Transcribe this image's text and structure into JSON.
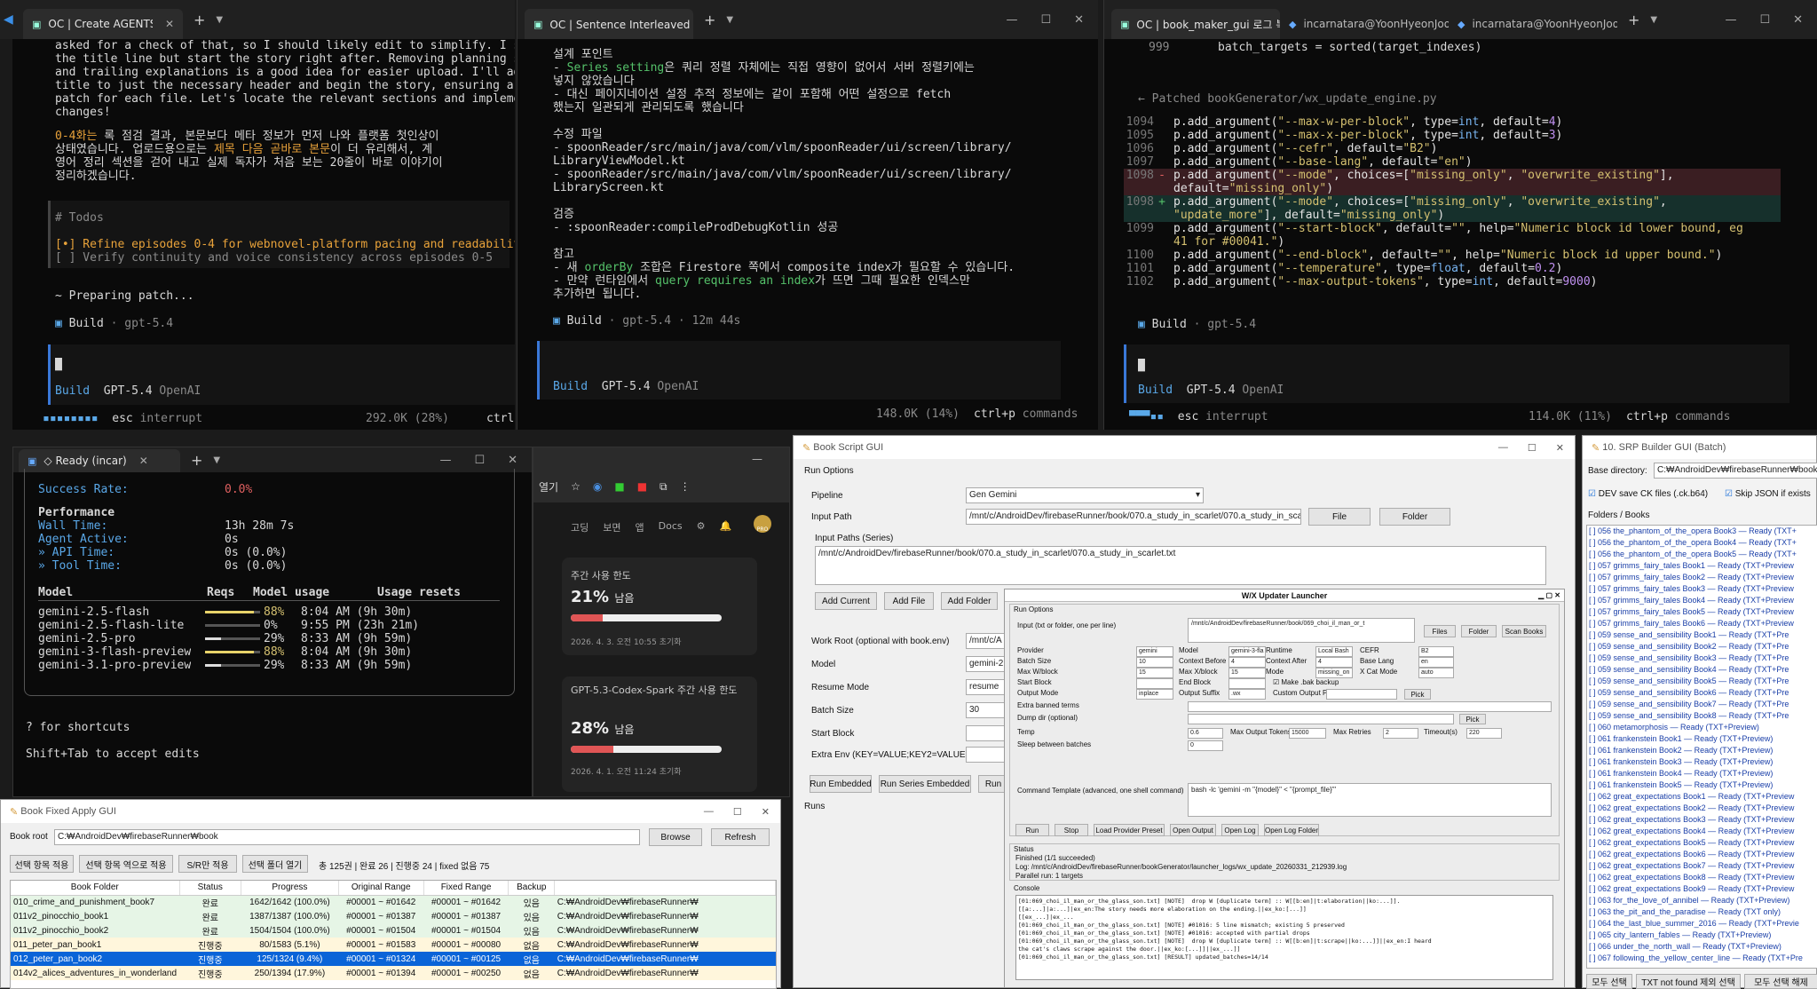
{
  "t1": {
    "tab": "OC | Create AGENTS.md for re",
    "lines": [
      "asked for a check of that, so I should likely edit to simplify. I sho",
      "the title line but start the story right after. Removing planning sec",
      "and trailing explanations is a good idea for easier upload. I'll adju",
      "title to just the necessary header and begin the story, ensuring a co",
      "patch for each file. Let's locate the relevant sections and implement",
      "changes!"
    ],
    "k1a": "0-4화는",
    "k1b": " 록 점검 결과, 본문보다 메타 정보가 먼저 나와 플랫폼 첫인상이",
    "k2a": "상태였습니다. 업로드용으로는 ",
    "k2b": "제목 다음 곧바로 본문",
    "k2c": "이 더 유리해서, 계",
    "k3": "영어 정리 섹션을 걷어 내고 실제 독자가 처음 보는 20줄이 바로 이야기이",
    "k4": "정리하겠습니다.",
    "todos_h": "# Todos",
    "todo1": "[•] Refine episodes 0-4 for webnovel-platform pacing and readability",
    "todo2": "[ ] Verify continuity and voice consistency across episodes 0-5",
    "prep": "~ Preparing patch...",
    "build": "Build",
    "model": "gpt-5.4",
    "b_build": "Build",
    "b_model": "GPT-5.4",
    "b_prov": "OpenAI",
    "esc": "esc",
    "interrupt": "interrupt",
    "tokens": "292.0K (28%)",
    "ctrl": "ctrl"
  },
  "t2": {
    "tab": "OC | Sentence Interleaved 원5",
    "h1": "설계 포인트",
    "a1": "- ",
    "a1k": "Series setting",
    "a1b": "은 쿼리 정렬 자체에는 직접 영향이 없어서 서버 정렬키에는",
    "a1c": "넣지 않았습니다",
    "a2": "- 대신 페이지네이션 설정 추적 정보에는 같이 포함해 어떤 설정으로 fetch",
    "a2b": "했는지 일관되게 관리되도록 했습니다",
    "h2": "수정 파일",
    "f1": "- spoonReader/src/main/java/com/vlm/spoonReader/ui/screen/library/",
    "f1b": "LibraryViewModel.kt",
    "f2": "- spoonReader/src/main/java/com/vlm/spoonReader/ui/screen/library/",
    "f2b": "LibraryScreen.kt",
    "h3": "검증",
    "v1a": "- ",
    "v1k": ":spoonReader:compileProdDebugKotlin",
    "v1b": " 성공",
    "h4": "참고",
    "r1a": "- 새 ",
    "r1k": "orderBy",
    "r1b": " 조합은 Firestore 쪽에서 composite index가 필요할 수 있습니다.",
    "r2a": "- 만약 런타임에서 ",
    "r2k": "query requires an index",
    "r2b": "가 뜨면 그때 필요한 인덱스만",
    "r3": "추가하면 됩니다.",
    "build": "Build",
    "model": "gpt-5.4",
    "time": "12m 44s",
    "b_build": "Build",
    "b_model": "GPT-5.4",
    "b_prov": "OpenAI",
    "tokens": "148.0K (14%)",
    "ctrlp": "ctrl+p",
    "commands": "commands"
  },
  "t3": {
    "tab1": "OC | book_maker_gui 로그 복.",
    "tab2": "incarnatara@YoonHyeonJoon:",
    "tab3": "incarnatara@YoonHyeonJoon:",
    "l999": "999",
    "c999": "batch_targets = sorted(target_indexes)",
    "patched": "← Patched bookGenerator/wx_update_engine.py",
    "rows": [
      {
        "n": "1094",
        "m": " ",
        "t": [
          [
            "p.add_argument(",
            ""
          ],
          [
            "\"--max-w-per-block\"",
            "s"
          ],
          [
            ", type=",
            ""
          ],
          [
            "int",
            "k"
          ],
          [
            ", default=",
            ""
          ],
          [
            "4",
            "n"
          ],
          [
            ")",
            ""
          ]
        ]
      },
      {
        "n": "1095",
        "m": " ",
        "t": [
          [
            "p.add_argument(",
            ""
          ],
          [
            "\"--max-x-per-block\"",
            "s"
          ],
          [
            ", type=",
            ""
          ],
          [
            "int",
            "k"
          ],
          [
            ", default=",
            ""
          ],
          [
            "3",
            "n"
          ],
          [
            ")",
            ""
          ]
        ]
      },
      {
        "n": "1096",
        "m": " ",
        "t": [
          [
            "p.add_argument(",
            ""
          ],
          [
            "\"--cefr\"",
            "s"
          ],
          [
            ", default=",
            ""
          ],
          [
            "\"B2\"",
            "s"
          ],
          [
            ")",
            ""
          ]
        ]
      },
      {
        "n": "1097",
        "m": " ",
        "t": [
          [
            "p.add_argument(",
            ""
          ],
          [
            "\"--base-lang\"",
            "s"
          ],
          [
            ", default=",
            ""
          ],
          [
            "\"en\"",
            "s"
          ],
          [
            ")",
            ""
          ]
        ]
      },
      {
        "n": "1098",
        "m": "-",
        "t": [
          [
            "p.add_argument(",
            ""
          ],
          [
            "\"--mode\"",
            "s"
          ],
          [
            ", choices=[",
            ""
          ],
          [
            "\"missing_only\"",
            "s"
          ],
          [
            ", ",
            ""
          ],
          [
            "\"overwrite_existing\"",
            "s"
          ],
          [
            "],",
            ""
          ]
        ]
      },
      {
        "n": "",
        "m": " ",
        "t": [
          [
            "default=",
            ""
          ],
          [
            "\"missing_only\"",
            "s"
          ],
          [
            ")",
            ""
          ]
        ]
      },
      {
        "n": "1098",
        "m": "+",
        "t": [
          [
            "p.add_argument(",
            ""
          ],
          [
            "\"--mode\"",
            "s"
          ],
          [
            ", choices=[",
            ""
          ],
          [
            "\"missing_only\"",
            "s"
          ],
          [
            ", ",
            ""
          ],
          [
            "\"overwrite_existing\"",
            "s"
          ],
          [
            ",",
            ""
          ]
        ]
      },
      {
        "n": "",
        "m": " ",
        "t": [
          [
            "\"update_more\"",
            "s"
          ],
          [
            "], default=",
            ""
          ],
          [
            "\"missing_only\"",
            "s"
          ],
          [
            ")",
            ""
          ]
        ]
      },
      {
        "n": "1099",
        "m": " ",
        "t": [
          [
            "p.add_argument(",
            ""
          ],
          [
            "\"--start-block\"",
            "s"
          ],
          [
            ", default=",
            ""
          ],
          [
            "\"\"",
            "s"
          ],
          [
            ", help=",
            ""
          ],
          [
            "\"Numeric block id lower bound, eg",
            "s"
          ]
        ]
      },
      {
        "n": "",
        "m": " ",
        "t": [
          [
            "41 for #00041.\"",
            "s"
          ],
          [
            ")",
            ""
          ]
        ]
      },
      {
        "n": "1100",
        "m": " ",
        "t": [
          [
            "p.add_argument(",
            ""
          ],
          [
            "\"--end-block\"",
            "s"
          ],
          [
            ", default=",
            ""
          ],
          [
            "\"\"",
            "s"
          ],
          [
            ", help=",
            ""
          ],
          [
            "\"Numeric block id upper bound.\"",
            "s"
          ],
          [
            ")",
            ""
          ]
        ]
      },
      {
        "n": "1101",
        "m": " ",
        "t": [
          [
            "p.add_argument(",
            ""
          ],
          [
            "\"--temperature\"",
            "s"
          ],
          [
            ", type=",
            ""
          ],
          [
            "float",
            "k"
          ],
          [
            ", default=",
            ""
          ],
          [
            "0.2",
            "n"
          ],
          [
            ")",
            ""
          ]
        ]
      },
      {
        "n": "1102",
        "m": " ",
        "t": [
          [
            "p.add_argument(",
            ""
          ],
          [
            "\"--max-output-tokens\"",
            "s"
          ],
          [
            ", type=",
            ""
          ],
          [
            "int",
            "k"
          ],
          [
            ", default=",
            ""
          ],
          [
            "9000",
            "n"
          ],
          [
            ")",
            ""
          ]
        ]
      }
    ],
    "build": "Build",
    "model": "gpt-5.4",
    "b_build": "Build",
    "b_model": "GPT-5.4",
    "b_prov": "OpenAI",
    "esc": "esc",
    "interrupt": "interrupt",
    "tokens": "114.0K (11%)",
    "ctrlp": "ctrl+p",
    "commands": "commands"
  },
  "t4": {
    "tab": "◇ Ready (incar)",
    "success_l": "Success Rate:",
    "success_v": "0.0%",
    "perf": "Performance",
    "wall_l": "Wall Time:",
    "wall_v": "13h 28m 7s",
    "agent_l": "Agent Active:",
    "agent_v": "0s",
    "api_l": "» API Time:",
    "api_v": "0s (0.0%)",
    "tool_l": "» Tool Time:",
    "tool_v": "0s (0.0%)",
    "cols": [
      "Model",
      "Reqs",
      "Model usage",
      "Usage resets"
    ],
    "models": [
      {
        "name": "gemini-2.5-flash",
        "reqs": "-",
        "pct": "88%",
        "frac": 0.88,
        "reset": "8:04 AM (9h 30m)",
        "hot": true
      },
      {
        "name": "gemini-2.5-flash-lite",
        "reqs": "-",
        "pct": "0%",
        "frac": 0.0,
        "reset": "9:55 PM (23h 21m)",
        "hot": false
      },
      {
        "name": "gemini-2.5-pro",
        "reqs": "-",
        "pct": "29%",
        "frac": 0.29,
        "reset": "8:33 AM (9h 59m)",
        "hot": false
      },
      {
        "name": "gemini-3-flash-preview",
        "reqs": "-",
        "pct": "88%",
        "frac": 0.88,
        "reset": "8:04 AM (9h 30m)",
        "hot": true
      },
      {
        "name": "gemini-3.1-pro-preview",
        "reqs": "-",
        "pct": "29%",
        "frac": 0.29,
        "reset": "8:33 AM (9h 59m)",
        "hot": false
      }
    ],
    "shortcuts": "? for shortcuts",
    "accept": "Shift+Tab to accept edits"
  },
  "browser": {
    "tab": "열기",
    "nav": [
      "고딩",
      "보면",
      "앱",
      "Docs"
    ],
    "u1_title": "주간 사용 한도",
    "u1_pct": "21%",
    "u1_suffix": "남음",
    "u1_frac": 0.21,
    "u1_date": "2026. 4. 3. 오전 10:55 초기화",
    "u2_title": "GPT-5.3-Codex-Spark 주간 사용 한도",
    "u2_pct": "28%",
    "u2_suffix": "남음",
    "u2_frac": 0.28,
    "u2_date": "2026. 4. 1. 오전 11:24 초기화",
    "avatar": "PRO"
  },
  "fixgui": {
    "title": "Book Fixed Apply GUI",
    "root_label": "Book root",
    "root_value": "C:₩AndroidDev₩firebaseRunner₩book",
    "browse": "Browse",
    "refresh": "Refresh",
    "actions": [
      "선택 항목 적용",
      "선택 항목 역으로 적용",
      "S/R만 적용",
      "선택 폴더 열기"
    ],
    "summary": "총 125권 | 완료 26 | 진행중 24 | fixed 없음 75",
    "cols": [
      "Book Folder",
      "Status",
      "Progress",
      "Original Range",
      "Fixed Range",
      "Backup",
      ""
    ],
    "rows": [
      [
        "010_crime_and_punishment_book7",
        "완료",
        "1642/1642 (100.0%)",
        "#00001 ~ #01642",
        "#00001 ~ #01642",
        "있음",
        "C:₩AndroidDev₩firebaseRunner₩"
      ],
      [
        "011v2_pinocchio_book1",
        "완료",
        "1387/1387 (100.0%)",
        "#00001 ~ #01387",
        "#00001 ~ #01387",
        "있음",
        "C:₩AndroidDev₩firebaseRunner₩"
      ],
      [
        "011v2_pinocchio_book2",
        "완료",
        "1504/1504 (100.0%)",
        "#00001 ~ #01504",
        "#00001 ~ #01504",
        "있음",
        "C:₩AndroidDev₩firebaseRunner₩"
      ],
      [
        "011_peter_pan_book1",
        "진행중",
        "80/1583 (5.1%)",
        "#00001 ~ #01583",
        "#00001 ~ #00080",
        "없음",
        "C:₩AndroidDev₩firebaseRunner₩"
      ],
      [
        "012_peter_pan_book2",
        "진행중",
        "125/1324 (9.4%)",
        "#00001 ~ #01324",
        "#00001 ~ #00125",
        "없음",
        "C:₩AndroidDev₩firebaseRunner₩"
      ],
      [
        "014v2_alices_adventures_in_wonderland",
        "진행중",
        "250/1394 (17.9%)",
        "#00001 ~ #01394",
        "#00001 ~ #00250",
        "없음",
        "C:₩AndroidDev₩firebaseRunner₩"
      ]
    ]
  },
  "bookscript": {
    "title": "Book Script GUI",
    "run_options": "Run Options",
    "pipeline_l": "Pipeline",
    "pipeline_v": "Gen Gemini",
    "input_l": "Input Path",
    "input_v": "/mnt/c/AndroidDev/firebaseRunner/book/070.a_study_in_scarlet/070.a_study_in_scarlet.txt",
    "file": "File",
    "folder": "Folder",
    "series_l": "Input Paths (Series)",
    "series_v": "/mnt/c/AndroidDev/firebaseRunner/book/070.a_study_in_scarlet/070.a_study_in_scarlet.txt",
    "add_current": "Add Current",
    "add_file": "Add File",
    "add_folder": "Add Folder",
    "workroot_l": "Work Root (optional with book.env)",
    "workroot_v": "/mnt/c/A",
    "model_l": "Model",
    "model_v": "gemini-2",
    "resume_l": "Resume Mode",
    "resume_v": "resume",
    "batch_l": "Batch Size",
    "batch_v": "30",
    "start_l": "Start Block",
    "extra_l": "Extra Env (KEY=VALUE;KEY2=VALUE2)",
    "run_emb": "Run Embedded",
    "run_series": "Run Series Embedded",
    "run_n": "Run N",
    "runs": "Runs"
  },
  "wx": {
    "title": "W/X Updater Launcher",
    "run_options": "Run Options",
    "input_l": "Input (txt or folder, one per line)",
    "input_v": "/mnt/c/AndroidDev/firebaseRunner/book/069_choi_il_man_or_t",
    "files": "Files",
    "folder": "Folder",
    "scan": "Scan Books",
    "provider_l": "Provider",
    "provider_v": "gemini",
    "model_l": "Model",
    "model_v": "gemini-3-fla",
    "runtime_l": "Runtime",
    "runtime_v": "Local Bash",
    "cefr_l": "CEFR",
    "cefr_v": "B2",
    "batch_l": "Batch Size",
    "batch_v": "10",
    "ctxb_l": "Context Before",
    "ctxb_v": "4",
    "ctxa_l": "Context After",
    "ctxa_v": "4",
    "base_l": "Base Lang",
    "base_v": "en",
    "maxw_l": "Max W/block",
    "maxw_v": "15",
    "maxx_l": "Max X/block",
    "maxx_v": "15",
    "mode_l": "Mode",
    "mode_v": "missing_on",
    "xcat_l": "X Cat Mode",
    "xcat_v": "auto",
    "startb_l": "Start Block",
    "endb_l": "End Block",
    "backup": "Make .bak backup",
    "outmode_l": "Output Mode",
    "outmode_v": "inplace",
    "outsuf_l": "Output Suffix",
    "outsuf_v": ".wx",
    "custom_l": "Custom Output Path",
    "pick": "Pick",
    "banned_l": "Extra banned terms",
    "dump_l": "Dump dir (optional)",
    "temp_l": "Temp",
    "temp_v": "0.6",
    "maxtok_l": "Max Output Tokens",
    "maxtok_v": "15000",
    "retries_l": "Max Retries",
    "retries_v": "2",
    "timeout_l": "Timeout(s)",
    "timeout_v": "220",
    "sleep_l": "Sleep between batches",
    "sleep_v": "0",
    "cmd_l": "Command Template (advanced, one shell command)",
    "cmd_v": "bash -lc 'gemini -m \"{model}\" < \"{prompt_file}\"'",
    "buttons": [
      "Run",
      "Stop",
      "Load Provider Preset",
      "Open Output",
      "Open Log",
      "Open Log Folder"
    ],
    "status_h": "Status",
    "status1": "Finished (1/1 succeeded)",
    "status2": "Log: /mnt/c/AndroidDev/firebaseRunner/bookGenerator/launcher_logs/wx_update_20260331_212939.log",
    "status3": "Parallel run: 1 targets",
    "console_h": "Console",
    "console": [
      "[01:069_choi_il_man_or_the_glass_son.txt] [NOTE]  drop W [duplicate term] :: W[[b:en]|t:elaboration||ko:...]].",
      "[[a:...]|a:...]|ex_en:The story needs more elaboration on the ending.||ex_ko:[...]]",
      "[[ex_...]|ex_...",
      "[01:069_choi_il_man_or_the_glass_son.txt] [NOTE] #01016: 5 line mismatch; existing 5 preserved",
      "[01:069_choi_il_man_or_the_glass_son.txt] [NOTE] #01016: accepted with partial drops",
      "[01:069_choi_il_man_or_the_glass_son.txt] [NOTE]  drop W [duplicate term] :: W[[b:en]|t:scrape||ko:...]]||ex_en:I heard",
      "the cat's claws scrape against the door.||ex_ko:[...]]||ex_...]]",
      "[01:069_choi_il_man_or_the_glass_son.txt] [RESULT] updated_batches=14/14"
    ]
  },
  "srp": {
    "title": "10. SRP Builder GUI (Batch)",
    "base_l": "Base directory:",
    "base_v": "C:₩AndroidDev₩firebaseRunner₩book",
    "dev_save": "DEV save CK files (.ck.b64)",
    "skip_json": "Skip JSON if exists",
    "folders_h": "Folders / Books",
    "items": [
      "[ ] 056 the_phantom_of_the_opera Book3 — Ready (TXT+",
      "[ ] 056 the_phantom_of_the_opera Book4 — Ready (TXT+",
      "[ ] 056 the_phantom_of_the_opera Book5 — Ready (TXT+",
      "[ ] 057 grimms_fairy_tales Book1 — Ready (TXT+Preview",
      "[ ] 057 grimms_fairy_tales Book2 — Ready (TXT+Preview",
      "[ ] 057 grimms_fairy_tales Book3 — Ready (TXT+Preview",
      "[ ] 057 grimms_fairy_tales Book4 — Ready (TXT+Preview",
      "[ ] 057 grimms_fairy_tales Book5 — Ready (TXT+Preview",
      "[ ] 057 grimms_fairy_tales Book6 — Ready (TXT+Preview",
      "[ ] 059 sense_and_sensibility Book1 — Ready (TXT+Pre",
      "[ ] 059 sense_and_sensibility Book2 — Ready (TXT+Pre",
      "[ ] 059 sense_and_sensibility Book3 — Ready (TXT+Pre",
      "[ ] 059 sense_and_sensibility Book4 — Ready (TXT+Pre",
      "[ ] 059 sense_and_sensibility Book5 — Ready (TXT+Pre",
      "[ ] 059 sense_and_sensibility Book6 — Ready (TXT+Pre",
      "[ ] 059 sense_and_sensibility Book7 — Ready (TXT+Pre",
      "[ ] 059 sense_and_sensibility Book8 — Ready (TXT+Pre",
      "[ ] 060 metamorphosis — Ready (TXT+Preview)",
      "[ ] 061 frankenstein Book1 — Ready (TXT+Preview)",
      "[ ] 061 frankenstein Book2 — Ready (TXT+Preview)",
      "[ ] 061 frankenstein Book3 — Ready (TXT+Preview)",
      "[ ] 061 frankenstein Book4 — Ready (TXT+Preview)",
      "[ ] 061 frankenstein Book5 — Ready (TXT+Preview)",
      "[ ] 062 great_expectations Book1 — Ready (TXT+Preview",
      "[ ] 062 great_expectations Book2 — Ready (TXT+Preview",
      "[ ] 062 great_expectations Book3 — Ready (TXT+Preview",
      "[ ] 062 great_expectations Book4 — Ready (TXT+Preview",
      "[ ] 062 great_expectations Book5 — Ready (TXT+Preview",
      "[ ] 062 great_expectations Book6 — Ready (TXT+Preview",
      "[ ] 062 great_expectations Book7 — Ready (TXT+Preview",
      "[ ] 062 great_expectations Book8 — Ready (TXT+Preview",
      "[ ] 062 great_expectations Book9 — Ready (TXT+Preview",
      "[ ] 063 for_the_love_of_annibel — Ready (TXT+Preview)",
      "[ ] 063 the_pit_and_the_paradise — Ready (TXT only)",
      "[ ] 064 the_last_blue_summer_2016 — Ready (TXT+Previe",
      "[ ] 065 city_lantern_fables — Ready (TXT+Preview)",
      "[ ] 066 under_the_north_wall — Ready (TXT+Preview)",
      "[ ] 067 following_the_yellow_center_line — Ready (TXT+Pre"
    ],
    "bottom": [
      "모두 선택",
      "TXT not found 제외 선택",
      "모두 선택 해제"
    ]
  }
}
